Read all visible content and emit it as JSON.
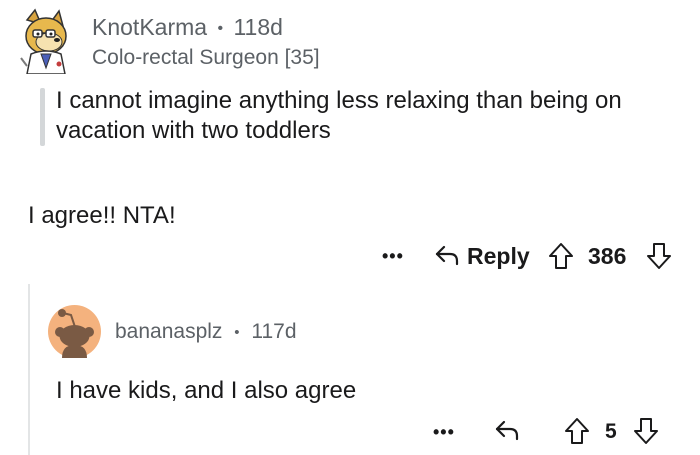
{
  "comment": {
    "username": "KnotKarma",
    "separator": "•",
    "age": "118d",
    "flair": "Colo-rectal Surgeon [35]",
    "quote": "I cannot imagine anything less relaxing than being on vacation with two toddlers",
    "body": "I agree!! NTA!",
    "actions": {
      "more": "•••",
      "reply_label": "Reply",
      "score": "386"
    }
  },
  "reply": {
    "username": "bananasplz",
    "separator": "•",
    "age": "117d",
    "body": "I have kids, and I also agree",
    "actions": {
      "more": "•••",
      "score": "5"
    }
  },
  "icons": {
    "avatar1": "doge-avatar",
    "avatar2": "default-snoo-avatar",
    "reply": "reply-arrow-icon",
    "upvote": "upvote-arrow-icon",
    "downvote": "downvote-arrow-icon"
  },
  "colors": {
    "text": "#1a1a1b",
    "meta": "#5c6166",
    "avatar2_bg": "#f4b27e",
    "quote_bar": "#d4d7d9"
  }
}
